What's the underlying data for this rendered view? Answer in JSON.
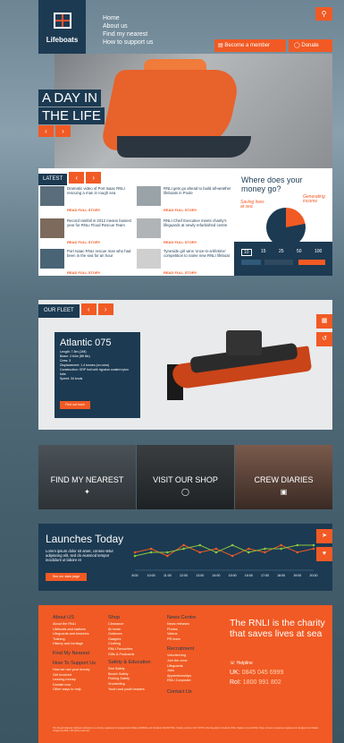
{
  "brand": {
    "name": "Lifeboats"
  },
  "topnav": {
    "items": [
      "Home",
      "About us",
      "Find my nearest",
      "How to support us"
    ]
  },
  "header": {
    "member_label": "Become a member",
    "donate_label": "Donate"
  },
  "hero": {
    "line1": "A DAY IN",
    "line2": "THE LIFE"
  },
  "latest": {
    "label": "LATEST",
    "items": [
      {
        "text": "Dramatic video of Port Isaac RNLI rescuing a man in rough sea",
        "link": "READ FULL STORY"
      },
      {
        "text": "RNLI gets go ahead to build all-weather lifeboats in Poole",
        "link": "READ FULL STORY"
      },
      {
        "text": "Record rainfall in 2012 means busiest year for RNLI Flood Rescue Team",
        "link": "READ FULL STORY"
      },
      {
        "text": "RNLI Chief Executive meets charity's lifeguards at newly refurbished centre",
        "link": "READ FULL STORY"
      },
      {
        "text": "Port Isaac RNLI rescue man who had been in the sea for an hour",
        "link": "READ FULL STORY"
      },
      {
        "text": "Tyneside girl wins 'once-in-a-lifetime' competition to name new RNLI lifeboat",
        "link": "READ FULL STORY"
      }
    ]
  },
  "money": {
    "title": "Where does your money go?",
    "label_a": "Saving lives at sea",
    "label_b": "Generating income",
    "amounts": [
      "10",
      "15",
      "25",
      "50",
      "100"
    ],
    "selected": "10"
  },
  "fleet": {
    "label": "OUR FLEET",
    "title": "Atlantic 075",
    "specs": [
      "Length: 7.5m (24ft)",
      "Beam: 2.64m (8ft 8in)",
      "Crew: 3",
      "Displacement: 1.4 tonnes (on crew)",
      "Construction: GRP hull with hypalon coated nylon tube",
      "Speed: 34 knots"
    ],
    "button": "Find out more"
  },
  "tiles": [
    {
      "label": "FIND MY NEAREST",
      "icon": "location-icon"
    },
    {
      "label": "VISIT OUR SHOP",
      "icon": "shop-icon"
    },
    {
      "label": "CREW DIARIES",
      "icon": "diary-icon"
    }
  ],
  "launches": {
    "title": "Launches Today",
    "text": "Lorem ipsum dolor sit amet, consec-tetur adipiscing elit, sed do eiusmod tempor incididunt ut labore et",
    "button": "See our stats page",
    "times": [
      "8:00",
      "10:00",
      "11:00",
      "12:00",
      "13:00",
      "14:00",
      "15:00",
      "16:00",
      "17:00",
      "18:00",
      "19:00",
      "20:00"
    ],
    "chart_data": {
      "type": "line",
      "series": [
        {
          "values": [
            4,
            5,
            3,
            6,
            4,
            5,
            3,
            5,
            4,
            6,
            4,
            5
          ]
        },
        {
          "values": [
            3,
            4,
            4,
            5,
            6,
            4,
            6,
            4,
            5,
            5,
            6,
            6
          ]
        }
      ],
      "colors": [
        "#f15a24",
        "#8dc63f"
      ]
    }
  },
  "footer": {
    "cols": [
      {
        "heading": "About US",
        "items": [
          "About the RNLI",
          "Lifeboats and stations",
          "Lifeguards and beaches",
          "Training",
          "History and heritage"
        ]
      },
      {
        "heading": "Find My Nearest",
        "items": []
      },
      {
        "heading": "How To Support Us",
        "items": [
          "How we use your money",
          "Get involved",
          "Leaving money",
          "Donate now",
          "Other ways to help"
        ]
      },
      {
        "heading": "Shop",
        "items": [
          "Clearance",
          "At home",
          "Outdoors",
          "Gadgets",
          "Clothing",
          "RNLI Favourites",
          "Gifts & Postcards"
        ]
      },
      {
        "heading": "Safety & Education",
        "items": [
          "Sea Safety",
          "Beach Safety",
          "Fishing Safety",
          "Snorkelling",
          "Youth and youth leaders"
        ]
      },
      {
        "heading": "News Centre",
        "items": [
          "News releases",
          "Photos",
          "Videos",
          "PR team"
        ]
      },
      {
        "heading": "Recruitment",
        "items": [
          "Volunteering",
          "Join the crew",
          "Lifeguards",
          "Jobs",
          "Apprenticeships",
          "RNLI Corporate"
        ]
      },
      {
        "heading": "Contact Us",
        "items": []
      }
    ],
    "tagline": "The RNLI is the charity that saves lives at sea",
    "helpline": "Helpline",
    "uk_label": "UK:",
    "uk_number": "0845 045 6999",
    "roi_label": "RoI:",
    "roi_number": "1800 991 802",
    "legal": "The Royal National Lifeboat Institution is a charity registered in England and Wales (209603) and Scotland (SC037736). Charity number CHY 2678 in the Republic of Ireland. RNLI (Sales) Ltd and RNLI Shop Ltd are companies registered in England and Wales. Images by RNLI. All rights reserved."
  },
  "colors": {
    "navy": "#1c3a52",
    "orange": "#f15a24"
  }
}
